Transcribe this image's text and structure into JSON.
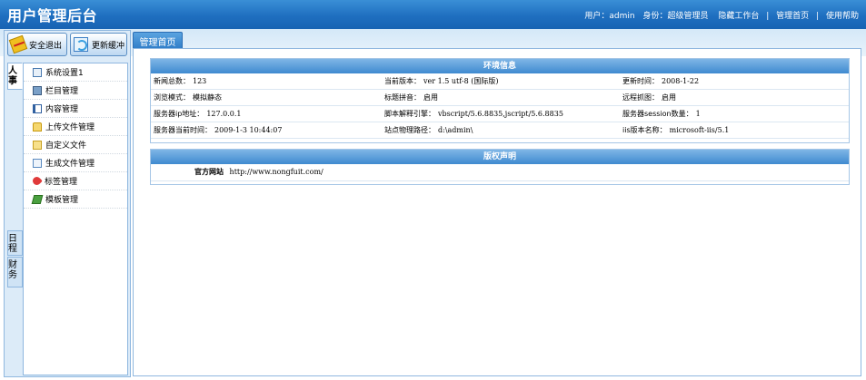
{
  "header": {
    "title": "用户管理后台",
    "user_label": "用户：",
    "user_name": "admin",
    "role_label": "身份：",
    "role_value": "超级管理员",
    "links": [
      "隐藏工作台",
      "管理首页",
      "使用帮助"
    ],
    "separator": "|"
  },
  "sidebar": {
    "buttons": {
      "exit": "安全退出",
      "refresh": "更新缓冲"
    },
    "vtabs": [
      "人事",
      "日程",
      "财务"
    ],
    "items": [
      {
        "label": "系统设置1",
        "icon": "settings-icon"
      },
      {
        "label": "栏目管理",
        "icon": "column-icon"
      },
      {
        "label": "内容管理",
        "icon": "content-icon"
      },
      {
        "label": "上传文件管理",
        "icon": "upload-icon"
      },
      {
        "label": "自定义文件",
        "icon": "folder-icon"
      },
      {
        "label": "生成文件管理",
        "icon": "generate-icon"
      },
      {
        "label": "标签管理",
        "icon": "tag-icon"
      },
      {
        "label": "模板管理",
        "icon": "template-icon"
      }
    ]
  },
  "main": {
    "tab": "管理首页",
    "env": {
      "title": "环境信息",
      "rows": [
        [
          {
            "label": "新闻总数：",
            "value": "123"
          },
          {
            "label": "当前版本：",
            "value": "ver 1.5 utf-8 (国际版)"
          },
          {
            "label": "更新时间：",
            "value": "2008-1-22"
          }
        ],
        [
          {
            "label": "浏览模式：",
            "value": "模拟静态"
          },
          {
            "label": "标题拼音：",
            "value": "启用"
          },
          {
            "label": "远程抓图：",
            "value": "启用"
          }
        ],
        [
          {
            "label": "服务器ip地址：",
            "value": "127.0.0.1"
          },
          {
            "label": "脚本解释引擎：",
            "value": "vbscript/5.6.8835,jscript/5.6.8835"
          },
          {
            "label": "服务器session数量：",
            "value": "1"
          }
        ],
        [
          {
            "label": "服务器当前时间：",
            "value": "2009-1-3 10:44:07"
          },
          {
            "label": "站点物理路径：",
            "value": "d:\\admin\\"
          },
          {
            "label": "iis版本名称：",
            "value": "microsoft-iis/5.1"
          }
        ]
      ]
    },
    "copyright": {
      "title": "版权声明",
      "label": "官方网站",
      "url": "http://www.nongfuit.com/"
    }
  },
  "colors": {
    "header_blue": "#1f6fc0",
    "panel_head": "#3f8ad0",
    "border": "#8fb7df"
  }
}
